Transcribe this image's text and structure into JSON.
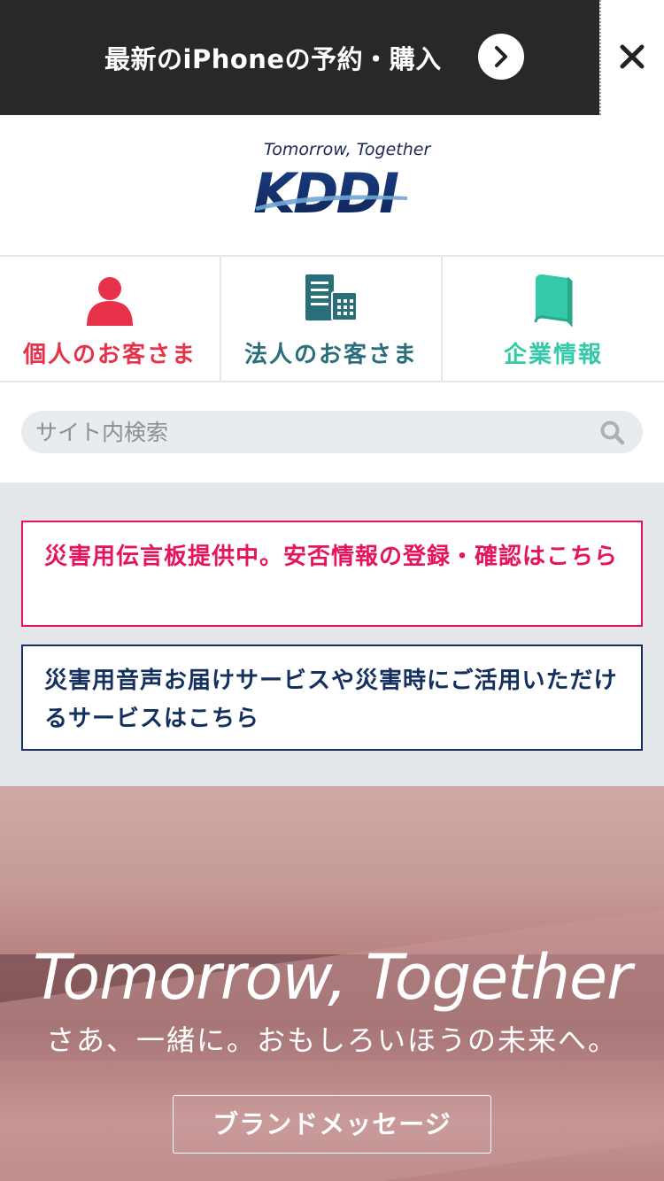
{
  "promo": {
    "text": "最新のiPhoneの予約・購入",
    "arrow_icon": "chevron-right-icon",
    "close_icon": "close-icon"
  },
  "logo": {
    "tagline": "Tomorrow, Together",
    "brand": "KDDI"
  },
  "categories": [
    {
      "label": "個人のお客さま",
      "icon": "person-icon",
      "color": "#e8324a"
    },
    {
      "label": "法人のお客さま",
      "icon": "building-icon",
      "color": "#2a6e7a"
    },
    {
      "label": "企業情報",
      "icon": "book-icon",
      "color": "#33c9a9"
    }
  ],
  "search": {
    "placeholder": "サイト内検索",
    "icon": "search-icon"
  },
  "notices": [
    {
      "text": "災害用伝言板提供中。安否情報の登録・確認はこちら",
      "color": "#e6135f"
    },
    {
      "text": "災害用音声お届けサービスや災害時にご活用いただけるサービスはこちら",
      "color": "#14305e"
    }
  ],
  "hero": {
    "title": "Tomorrow, Together",
    "subtitle": "さあ、一緒に。おもしろいほうの未来へ。",
    "button_label": "ブランドメッセージ"
  }
}
